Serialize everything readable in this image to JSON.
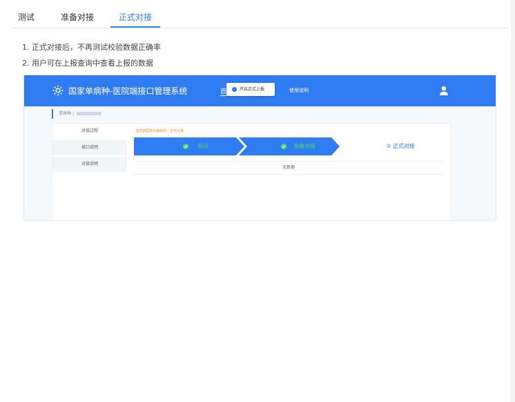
{
  "tabs": [
    {
      "label": "测试",
      "active": false
    },
    {
      "label": "准备对接",
      "active": false
    },
    {
      "label": "正式对接",
      "active": true
    }
  ],
  "notes": [
    "1. 正式对接后，不再测试校验数据正确率",
    "2. 用户可在上报查询中查看上报的数据"
  ],
  "screenshot": {
    "app_title": "国家单病种-医院端接口管理系统",
    "nav_home": "首",
    "tooltip": "开启正式上报",
    "nav_usage": "使用说明",
    "breadcrumb": "单病种 /",
    "sidenav": [
      "对接过程",
      "接口说明",
      "对接说明"
    ],
    "hint": "当前该医院对接状态：正式对接",
    "steps": [
      {
        "label": "测试",
        "status": "done"
      },
      {
        "label": "准备对接",
        "status": "done"
      },
      {
        "label": "③ 正式对接",
        "status": "current"
      }
    ],
    "no_data": "无数据"
  },
  "colors": {
    "accent": "#2f80f0",
    "header_blue": "#2f7bf2",
    "step_done_text": "#4cd964",
    "hint_orange": "#f08c2a"
  }
}
